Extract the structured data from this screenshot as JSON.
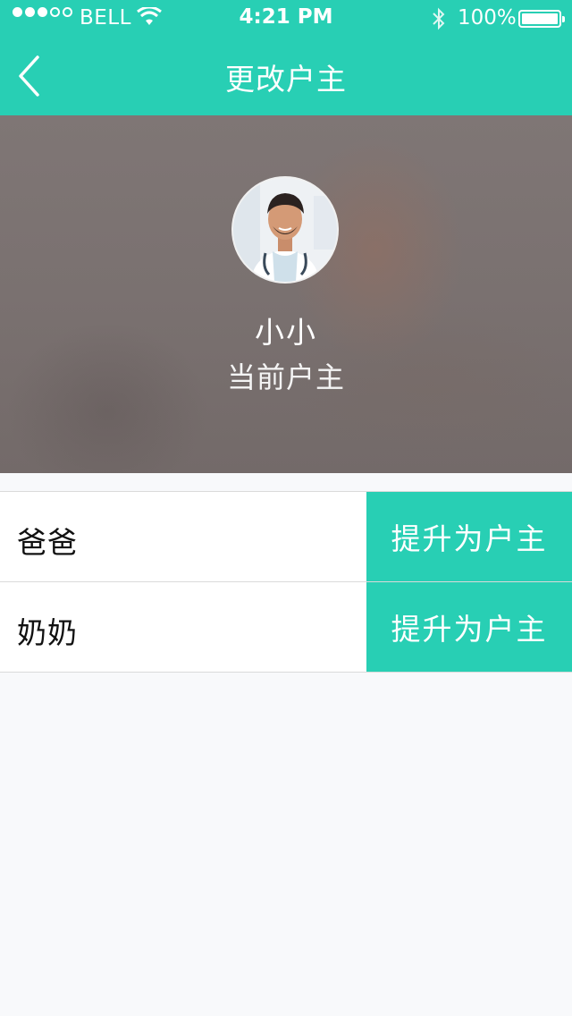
{
  "status_bar": {
    "carrier": "BELL",
    "time": "4:21 PM",
    "battery": "100%"
  },
  "nav": {
    "title": "更改户主"
  },
  "profile": {
    "name": "小小",
    "role": "当前户主"
  },
  "members": [
    {
      "name": "爸爸",
      "action_label": "提升为户主"
    },
    {
      "name": "奶奶",
      "action_label": "提升为户主"
    }
  ],
  "colors": {
    "accent": "#28cfb4",
    "background": "#f8f9fb"
  }
}
